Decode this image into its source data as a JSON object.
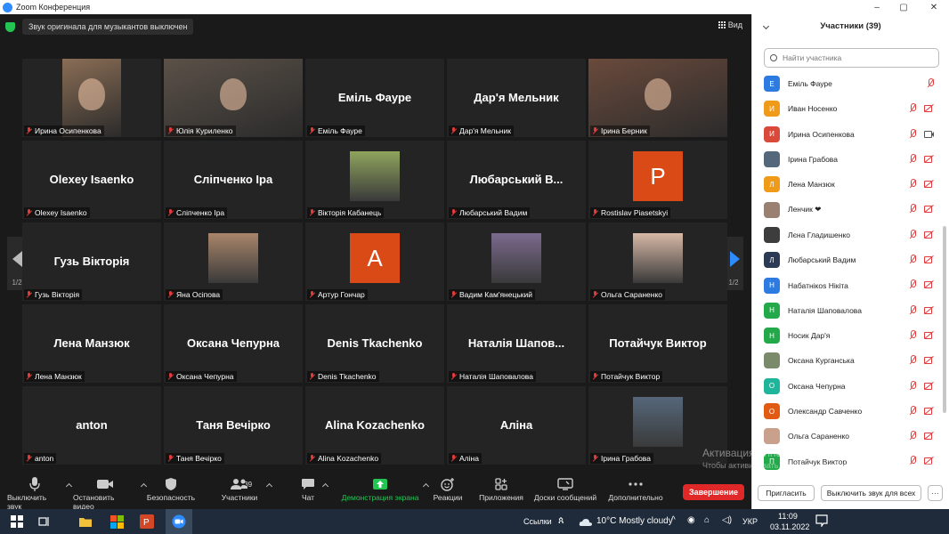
{
  "window": {
    "title": "Zoom Конференция",
    "minimize": "–",
    "maximize": "▢",
    "close": "✕"
  },
  "meeting": {
    "notice": "Звук оригинала для музыкантов выключен",
    "view_label": "Вид",
    "page_indicator": "1/2"
  },
  "tiles": [
    {
      "name": "Ирина Осипенкова",
      "kind": "photo",
      "photo_color": "#8a6d55"
    },
    {
      "name": "Юлія Куриленко",
      "kind": "photo",
      "photo_color": "#5b5148"
    },
    {
      "name": "Еміль Фауре",
      "kind": "name",
      "display": "Еміль Фауре"
    },
    {
      "name": "Дар'я Мельник",
      "kind": "name",
      "display": "Дар'я Мельник"
    },
    {
      "name": "Ірина Берник",
      "kind": "photo",
      "photo_color": "#6a4a3c",
      "active": true
    },
    {
      "name": "Olexey Isaenko",
      "kind": "name",
      "display": "Olexey Isaenko"
    },
    {
      "name": "Сліпченко Іра",
      "kind": "name",
      "display": "Сліпченко Іра"
    },
    {
      "name": "Вікторія Кабанець",
      "kind": "avatar",
      "avatar_color": "#8fa45c"
    },
    {
      "name": "Любарський Вадим",
      "kind": "name",
      "display": "Любарський В..."
    },
    {
      "name": "Rostislav Piasetskyi",
      "kind": "letter",
      "letter": "P",
      "letter_color": "#d94a17"
    },
    {
      "name": "Гузь Вікторія",
      "kind": "name",
      "display": "Гузь Вікторія"
    },
    {
      "name": "Яна Осіпова",
      "kind": "avatar",
      "avatar_color": "#a9856a"
    },
    {
      "name": "Артур Гончар",
      "kind": "letter",
      "letter": "A",
      "letter_color": "#d94a17"
    },
    {
      "name": "Вадим Кам'янецький",
      "kind": "avatar",
      "avatar_color": "#7b6a8e"
    },
    {
      "name": "Ольга Сараненко",
      "kind": "avatar",
      "avatar_color": "#d7b8a6"
    },
    {
      "name": "Лена Манзюк",
      "kind": "name",
      "display": "Лена Манзюк"
    },
    {
      "name": "Оксана Чепурна",
      "kind": "name",
      "display": "Оксана Чепурна"
    },
    {
      "name": "Denis Tkachenko",
      "kind": "name",
      "display": "Denis Tkachenko"
    },
    {
      "name": "Наталія Шаповалова",
      "kind": "name",
      "display": "Наталія Шапов..."
    },
    {
      "name": "Потайчук Виктор",
      "kind": "name",
      "display": "Потайчук Виктор"
    },
    {
      "name": "anton",
      "kind": "name",
      "display": "anton"
    },
    {
      "name": "Таня Вечірко",
      "kind": "name",
      "display": "Таня Вечірко"
    },
    {
      "name": "Alina Kozachenko",
      "kind": "name",
      "display": "Alina Kozachenko"
    },
    {
      "name": "Аліна",
      "kind": "name",
      "display": "Аліна"
    },
    {
      "name": "Ірина Грабова",
      "kind": "avatar",
      "avatar_color": "#55677a"
    }
  ],
  "toolbar": {
    "mute": "Выключить звук",
    "video": "Остановить видео",
    "security": "Безопасность",
    "participants": "Участники",
    "participants_count": "39",
    "chat": "Чат",
    "share": "Демонстрация экрана",
    "reactions": "Реакции",
    "apps": "Приложения",
    "rooms": "Доски сообщений",
    "more": "Дополнительно",
    "end": "Завершение"
  },
  "panel": {
    "title": "Участники (39)",
    "search_placeholder": "Найти участника",
    "invite": "Пригласить",
    "mute_all": "Выключить звук для всех",
    "more": "···",
    "participants": [
      {
        "name": "Еміль Фауре",
        "initial": "Е",
        "color": "#2d7be0",
        "icons": [
          "mic-off"
        ]
      },
      {
        "name": "Иван Носенко",
        "initial": "И",
        "color": "#f09a1a",
        "icons": [
          "mic-off",
          "cam-off"
        ]
      },
      {
        "name": "Ирина Осипенкова",
        "initial": "И",
        "color": "#d94a3a",
        "icons": [
          "mic-off",
          "cam-on"
        ]
      },
      {
        "name": "Ірина Грабова",
        "initial": "",
        "color": "#55677a",
        "icons": [
          "mic-off",
          "cam-off"
        ]
      },
      {
        "name": "Лена Манзюк",
        "initial": "Л",
        "color": "#f09a1a",
        "icons": [
          "mic-off",
          "cam-off"
        ]
      },
      {
        "name": "Ленчик ❤",
        "initial": "",
        "color": "#9a8070",
        "icons": [
          "mic-off",
          "cam-off"
        ]
      },
      {
        "name": "Лєна Гладишенко",
        "initial": "",
        "color": "#3d3d3d",
        "icons": [
          "mic-off",
          "cam-off"
        ]
      },
      {
        "name": "Любарський Вадим",
        "initial": "Л",
        "color": "#2b3a55",
        "icons": [
          "mic-off",
          "cam-off"
        ]
      },
      {
        "name": "Набатнікоs Нікіта",
        "initial": "Н",
        "color": "#2d7be0",
        "icons": [
          "mic-off",
          "cam-off"
        ]
      },
      {
        "name": "Наталія Шаповалова",
        "initial": "Н",
        "color": "#23a94a",
        "icons": [
          "mic-off",
          "cam-off"
        ]
      },
      {
        "name": "Носик Дар'я",
        "initial": "Н",
        "color": "#23a94a",
        "icons": [
          "mic-off",
          "cam-off"
        ]
      },
      {
        "name": "Оксана Курганська",
        "initial": "",
        "color": "#7a8a6a",
        "icons": [
          "mic-off",
          "cam-off"
        ]
      },
      {
        "name": "Оксана Чепурна",
        "initial": "О",
        "color": "#1fb59a",
        "icons": [
          "mic-off",
          "cam-off"
        ]
      },
      {
        "name": "Олександр Савченко",
        "initial": "О",
        "color": "#e25b12",
        "icons": [
          "mic-off",
          "cam-off"
        ]
      },
      {
        "name": "Ольга Сараненко",
        "initial": "",
        "color": "#c9a08c",
        "icons": [
          "mic-off",
          "cam-off"
        ]
      },
      {
        "name": "Потайчук Виктор",
        "initial": "П",
        "color": "#23a94a",
        "icons": [
          "mic-off",
          "cam-off"
        ]
      }
    ]
  },
  "watermark": {
    "line1": "Активация Windows",
    "line2": "Чтобы активировать Windows, перейдите в раздел \"Параметры\"."
  },
  "taskbar": {
    "links_label": "Ссылки",
    "weather": "10°C  Mostly cloudy",
    "lang": "УКР",
    "time": "11:09",
    "date": "03.11.2022"
  },
  "colors": {
    "accent": "#2d8cff",
    "end_red": "#e02828",
    "share_green": "#23c552",
    "active_speaker": "#e8e35a"
  }
}
